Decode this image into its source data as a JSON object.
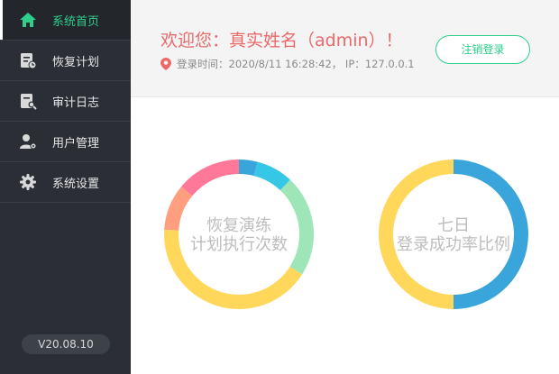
{
  "sidebar": {
    "items": [
      {
        "label": "系统首页",
        "icon": "home-icon",
        "active": true
      },
      {
        "label": "恢复计划",
        "icon": "plan-icon",
        "active": false
      },
      {
        "label": "审计日志",
        "icon": "audit-log-icon",
        "active": false
      },
      {
        "label": "用户管理",
        "icon": "user-manage-icon",
        "active": false
      },
      {
        "label": "系统设置",
        "icon": "gear-icon",
        "active": false
      }
    ],
    "version": "V20.08.10"
  },
  "header": {
    "welcome": "欢迎您：真实姓名（admin）！",
    "login_info": "登录时间：2020/8/11  16:28:42，  IP：127.0.0.1",
    "logout_label": "注销登录"
  },
  "colors": {
    "accent": "#2ecf8a",
    "welcome": "#ea6a6a"
  },
  "chart_data": [
    {
      "type": "pie",
      "donut": true,
      "title": "恢复演练\n计划执行次数",
      "title_lines": [
        "恢复演练",
        "计划执行次数"
      ],
      "slices": [
        {
          "value": 4,
          "color": "#3aa5da"
        },
        {
          "value": 8,
          "color": "#36c6e6"
        },
        {
          "value": 22,
          "color": "#9ee6b7"
        },
        {
          "value": 42,
          "color": "#ffd75a"
        },
        {
          "value": 10,
          "color": "#ff9f7f"
        },
        {
          "value": 14,
          "color": "#ff7799"
        }
      ]
    },
    {
      "type": "pie",
      "donut": true,
      "title": "七日\n登录成功率比例",
      "title_lines": [
        "七日",
        "登录成功率比例"
      ],
      "slices": [
        {
          "value": 50,
          "color": "#3aa5da"
        },
        {
          "value": 50,
          "color": "#ffd75a"
        }
      ]
    }
  ]
}
